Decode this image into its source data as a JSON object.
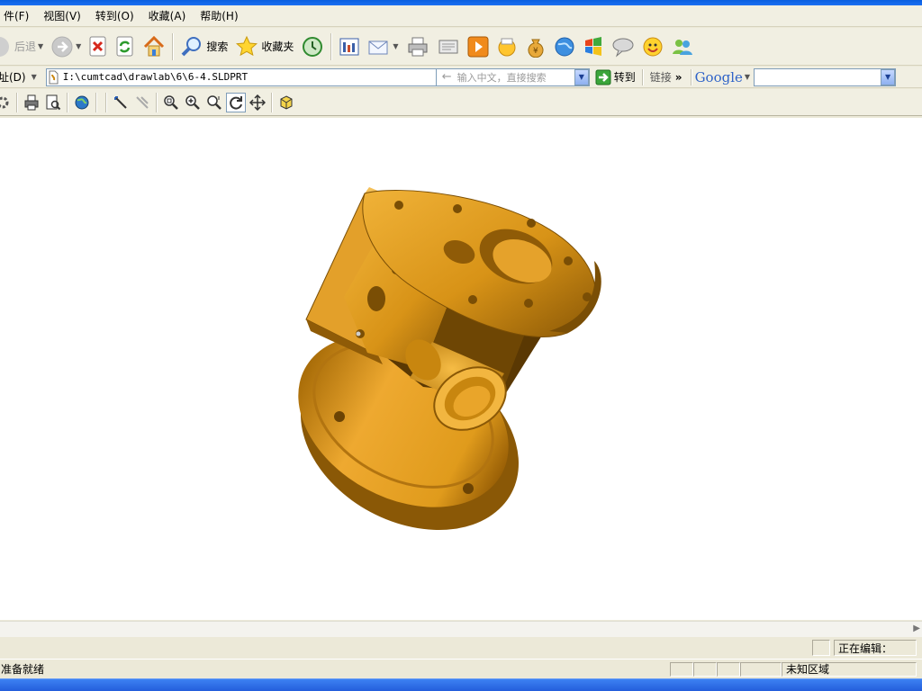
{
  "menu": [
    "件(F)",
    "视图(V)",
    "转到(O)",
    "收藏(A)",
    "帮助(H)"
  ],
  "toolbar": {
    "back_label": "后退",
    "search_label": "搜索",
    "favorites_label": "收藏夹"
  },
  "address": {
    "label": "址(D)",
    "value": "I:\\cumtcad\\drawlab\\6\\6-4.SLDPRT",
    "search_hint": "输入中文，直接搜索",
    "go_label": "转到",
    "links_label": "链接",
    "links_chevron": "»",
    "google_label": "Google"
  },
  "status": {
    "ready": "准备就绪",
    "editing": "正在编辑：",
    "zone": "未知区域"
  },
  "colors": {
    "part_light": "#e8a52c",
    "part_mid": "#c98712",
    "part_dark": "#7a4e05",
    "part_shadow": "#4f3203"
  }
}
